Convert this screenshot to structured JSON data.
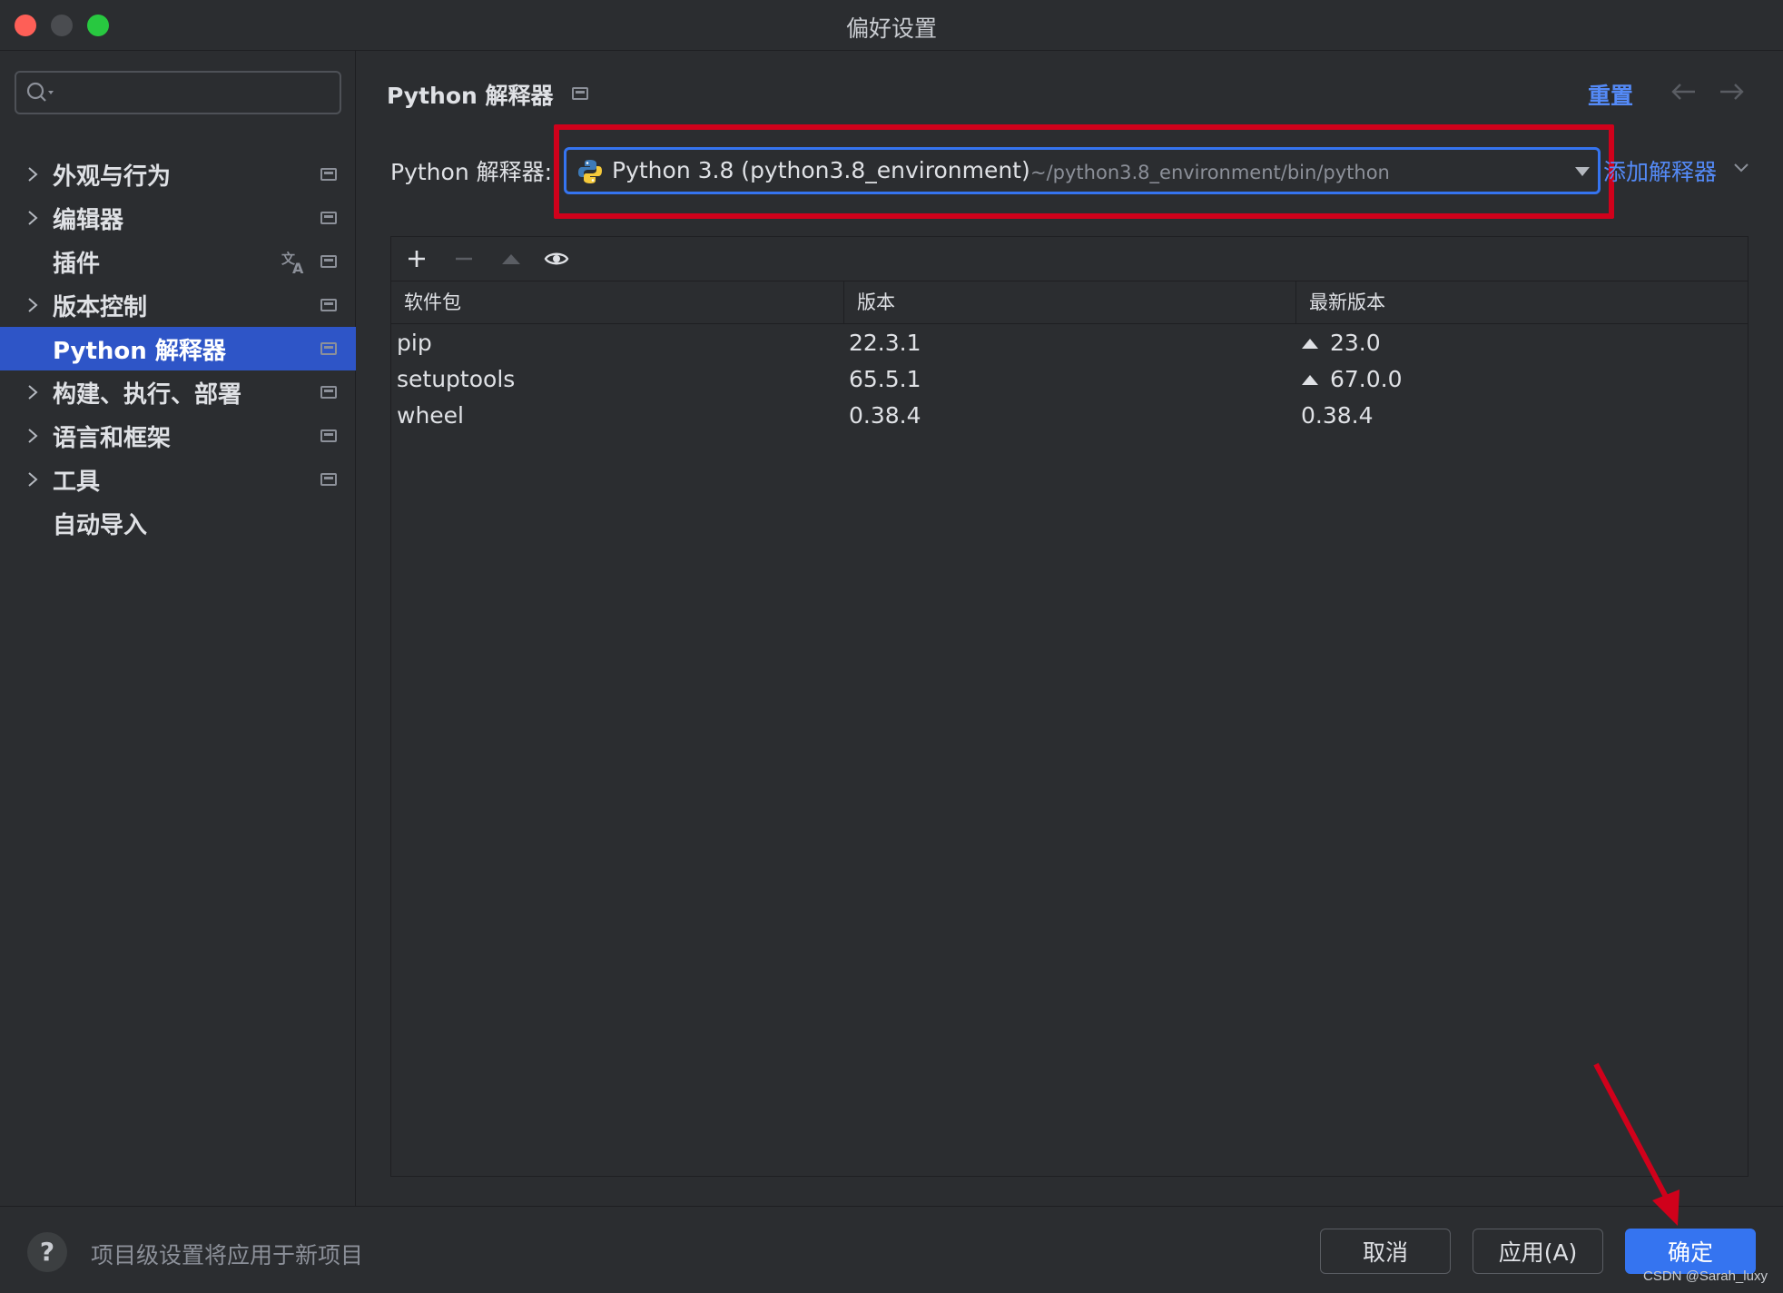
{
  "window": {
    "title": "偏好设置"
  },
  "sidebar": {
    "search": {
      "value": "",
      "placeholder": ""
    },
    "items": [
      {
        "label": "外观与行为",
        "expandable": true,
        "active": false
      },
      {
        "label": "编辑器",
        "expandable": true,
        "active": false
      },
      {
        "label": "插件",
        "expandable": false,
        "active": false,
        "translate_icon": true
      },
      {
        "label": "版本控制",
        "expandable": true,
        "active": false
      },
      {
        "label": "Python 解释器",
        "expandable": false,
        "active": true
      },
      {
        "label": "构建、执行、部署",
        "expandable": true,
        "active": false
      },
      {
        "label": "语言和框架",
        "expandable": true,
        "active": false
      },
      {
        "label": "工具",
        "expandable": true,
        "active": false
      },
      {
        "label": "自动导入",
        "expandable": false,
        "active": false
      }
    ]
  },
  "main": {
    "title": "Python 解释器",
    "reset_label": "重置",
    "interpreter": {
      "label": "Python 解释器:",
      "name": "Python 3.8 (python3.8_environment)",
      "path": "~/python3.8_environment/bin/python",
      "add_label": "添加解释器"
    },
    "packages": {
      "columns": [
        "软件包",
        "版本",
        "最新版本"
      ],
      "rows": [
        {
          "name": "pip",
          "version": "22.3.1",
          "latest": "23.0",
          "upgrade": true
        },
        {
          "name": "setuptools",
          "version": "65.5.1",
          "latest": "67.0.0",
          "upgrade": true
        },
        {
          "name": "wheel",
          "version": "0.38.4",
          "latest": "0.38.4",
          "upgrade": false
        }
      ]
    }
  },
  "footer": {
    "help_label": "?",
    "note": "项目级设置将应用于新项目",
    "cancel_label": "取消",
    "apply_label": "应用(A)",
    "ok_label": "确定",
    "watermark": "CSDN @Sarah_luxy"
  },
  "colors": {
    "background": "#2b2d30",
    "accent": "#3574f0",
    "active_nav": "#2e55c7",
    "link": "#548af7",
    "annotation_red": "#d0011b"
  }
}
